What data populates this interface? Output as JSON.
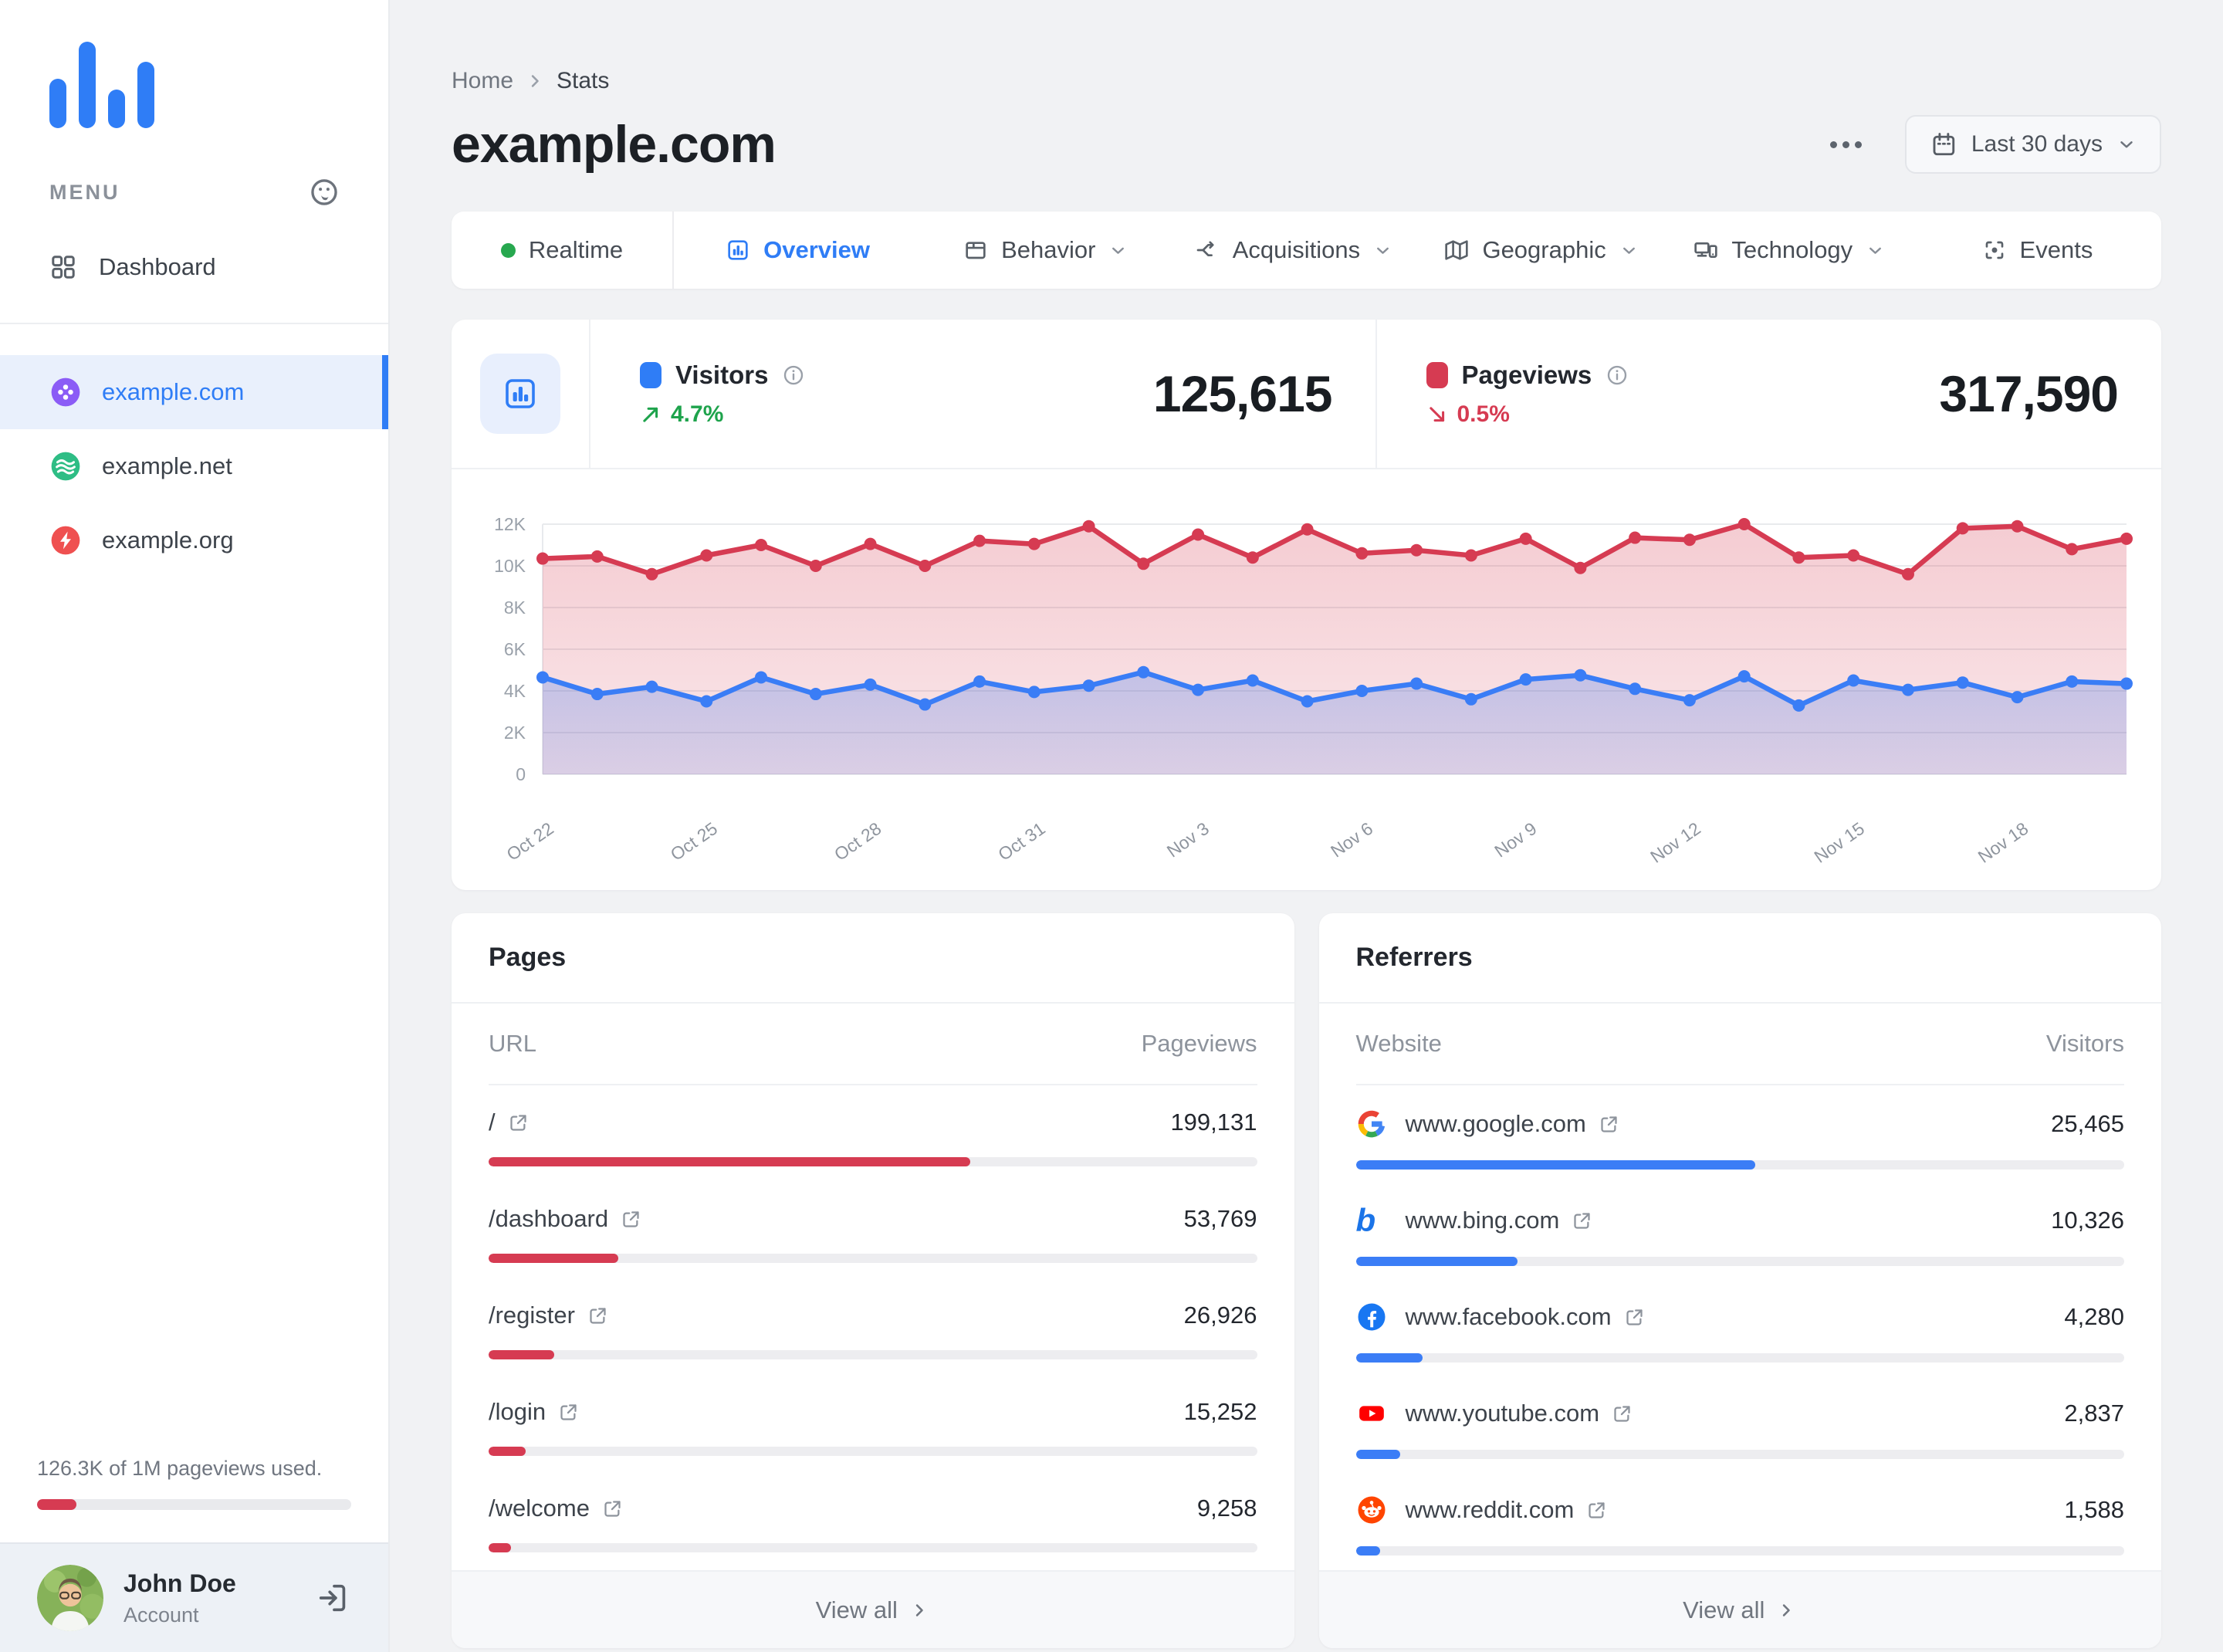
{
  "sidebar": {
    "menu_label": "MENU",
    "dashboard_label": "Dashboard",
    "sites": [
      {
        "name": "example.com",
        "active": true,
        "icon": "clover-icon",
        "color": "#8B5CF6"
      },
      {
        "name": "example.net",
        "active": false,
        "icon": "waves-icon",
        "color": "#2EBD85"
      },
      {
        "name": "example.org",
        "active": false,
        "icon": "bolt-icon",
        "color": "#EF5050"
      }
    ],
    "usage_text": "126.3K of 1M pageviews used.",
    "usage_pct": 12.6,
    "account": {
      "name": "John Doe",
      "role": "Account"
    }
  },
  "header": {
    "breadcrumb": {
      "home": "Home",
      "current": "Stats"
    },
    "title": "example.com",
    "date_range": "Last 30 days"
  },
  "tabs": [
    {
      "label": "Realtime"
    },
    {
      "label": "Overview",
      "active": true
    },
    {
      "label": "Behavior",
      "has_menu": true
    },
    {
      "label": "Acquisitions",
      "has_menu": true
    },
    {
      "label": "Geographic",
      "has_menu": true
    },
    {
      "label": "Technology",
      "has_menu": true
    },
    {
      "label": "Events"
    }
  ],
  "stats": {
    "visitors": {
      "label": "Visitors",
      "value": "125,615",
      "delta": "4.7%",
      "trend": "up",
      "color": "#2F7DF6"
    },
    "pageviews": {
      "label": "Pageviews",
      "value": "317,590",
      "delta": "0.5%",
      "trend": "down",
      "color": "#D63B52"
    }
  },
  "chart_data": {
    "type": "area",
    "title": "",
    "xlabel": "",
    "ylabel": "",
    "grid": true,
    "legend": "none",
    "ylim": [
      0,
      12000
    ],
    "yticks": [
      "0",
      "2K",
      "4K",
      "6K",
      "8K",
      "10K",
      "12K"
    ],
    "xtick_every": 3,
    "x": [
      "Oct 22",
      "Oct 23",
      "Oct 24",
      "Oct 25",
      "Oct 26",
      "Oct 27",
      "Oct 28",
      "Oct 29",
      "Oct 30",
      "Oct 31",
      "Nov 1",
      "Nov 2",
      "Nov 3",
      "Nov 4",
      "Nov 5",
      "Nov 6",
      "Nov 7",
      "Nov 8",
      "Nov 9",
      "Nov 10",
      "Nov 11",
      "Nov 12",
      "Nov 13",
      "Nov 14",
      "Nov 15",
      "Nov 16",
      "Nov 17",
      "Nov 18",
      "Nov 19",
      "Nov 20"
    ],
    "series": [
      {
        "name": "Visitors",
        "color": "#3A7DF6",
        "values": [
          4650,
          3850,
          4200,
          3500,
          4650,
          3850,
          4300,
          3350,
          4450,
          3950,
          4250,
          4900,
          4050,
          4500,
          3500,
          4000,
          4350,
          3600,
          4550,
          4750,
          4100,
          3550,
          4700,
          3300,
          4500,
          4050,
          4400,
          3700,
          4450,
          4350
        ]
      },
      {
        "name": "Pageviews",
        "color": "#D63B52",
        "values": [
          10350,
          10450,
          9600,
          10500,
          11000,
          10000,
          11050,
          10000,
          11200,
          11050,
          11900,
          10100,
          11500,
          10400,
          11750,
          10600,
          10750,
          10500,
          11300,
          9900,
          11350,
          11250,
          12000,
          10400,
          10500,
          9600,
          11800,
          11900,
          10800,
          11300
        ]
      }
    ]
  },
  "pages": {
    "title": "Pages",
    "col_left": "URL",
    "col_right": "Pageviews",
    "rows": [
      {
        "label": "/",
        "value": "199,131",
        "pct": 62.7
      },
      {
        "label": "/dashboard",
        "value": "53,769",
        "pct": 16.9
      },
      {
        "label": "/register",
        "value": "26,926",
        "pct": 8.5
      },
      {
        "label": "/login",
        "value": "15,252",
        "pct": 4.8
      },
      {
        "label": "/welcome",
        "value": "9,258",
        "pct": 2.9
      }
    ]
  },
  "referrers": {
    "title": "Referrers",
    "col_left": "Website",
    "col_right": "Visitors",
    "rows": [
      {
        "label": "www.google.com",
        "value": "25,465",
        "pct": 52,
        "icon": "google-favicon"
      },
      {
        "label": "www.bing.com",
        "value": "10,326",
        "pct": 21,
        "icon": "bing-favicon"
      },
      {
        "label": "www.facebook.com",
        "value": "4,280",
        "pct": 8.7,
        "icon": "facebook-favicon"
      },
      {
        "label": "www.youtube.com",
        "value": "2,837",
        "pct": 5.8,
        "icon": "youtube-favicon"
      },
      {
        "label": "www.reddit.com",
        "value": "1,588",
        "pct": 3.2,
        "icon": "reddit-favicon"
      }
    ]
  },
  "labels": {
    "view_all": "View all"
  }
}
